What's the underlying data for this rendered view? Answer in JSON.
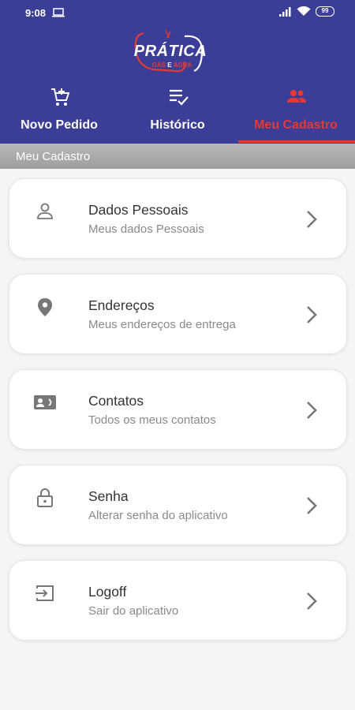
{
  "status": {
    "time": "9:08",
    "battery": "99"
  },
  "logo": {
    "title": "PRÁTICA",
    "sub_left": "GÁS",
    "sub_mid": "E",
    "sub_right": "ÁGUA"
  },
  "tabs": [
    {
      "label": "Novo Pedido",
      "icon": "cart-add-icon"
    },
    {
      "label": "Histórico",
      "icon": "list-check-icon"
    },
    {
      "label": "Meu Cadastro",
      "icon": "people-icon",
      "active": true
    }
  ],
  "section_title": "Meu Cadastro",
  "menu": [
    {
      "title": "Dados Pessoais",
      "subtitle": "Meus dados Pessoais",
      "icon": "person-icon"
    },
    {
      "title": "Endereços",
      "subtitle": "Meus endereços de entrega",
      "icon": "location-pin-icon"
    },
    {
      "title": "Contatos",
      "subtitle": "Todos os meus contatos",
      "icon": "contact-card-icon"
    },
    {
      "title": "Senha",
      "subtitle": "Alterar senha do aplicativo",
      "icon": "lock-icon"
    },
    {
      "title": "Logoff",
      "subtitle": "Sair do aplicativo",
      "icon": "logout-icon"
    }
  ],
  "colors": {
    "primary": "#3b3d96",
    "accent": "#e53935",
    "header": "#a6a6a6"
  }
}
